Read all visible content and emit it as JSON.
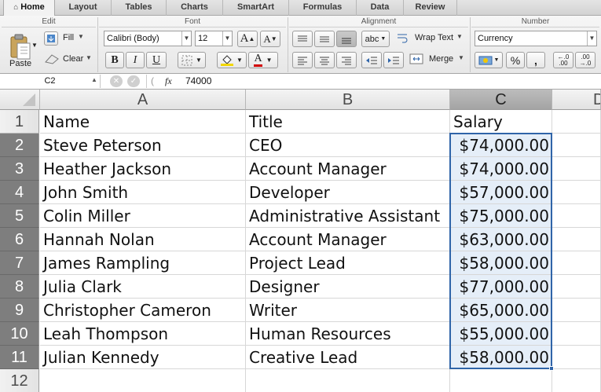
{
  "ribbon_tabs": [
    "Home",
    "Layout",
    "Tables",
    "Charts",
    "SmartArt",
    "Formulas",
    "Data",
    "Review"
  ],
  "groups": {
    "edit": "Edit",
    "font": "Font",
    "alignment": "Alignment",
    "number": "Number"
  },
  "edit": {
    "paste": "Paste",
    "fill": "Fill",
    "clear": "Clear"
  },
  "font": {
    "name": "Calibri (Body)",
    "size": "12",
    "grow": "A",
    "shrink": "A",
    "bold": "B",
    "italic": "I",
    "underline": "U",
    "font_color": "A"
  },
  "alignment": {
    "wrap_text": "Wrap Text",
    "merge": "Merge",
    "orientation": "abc"
  },
  "number": {
    "format": "Currency",
    "percent": "%",
    "comma": ",",
    "inc_decimal": ".0\n.00",
    "dec_decimal": ".00\n.0"
  },
  "formula_bar": {
    "name_box": "C2",
    "fx": "fx",
    "value": "74000"
  },
  "columns": [
    "A",
    "B",
    "C"
  ],
  "next_column_partial": "D",
  "rows": [
    {
      "n": "1",
      "a": "Name",
      "b": "Title",
      "c": "Salary"
    },
    {
      "n": "2",
      "a": "Steve Peterson",
      "b": "CEO",
      "c": "$74,000.00"
    },
    {
      "n": "3",
      "a": "Heather Jackson",
      "b": "Account Manager",
      "c": "$74,000.00"
    },
    {
      "n": "4",
      "a": "John Smith",
      "b": "Developer",
      "c": "$57,000.00"
    },
    {
      "n": "5",
      "a": "Colin Miller",
      "b": "Administrative Assistant",
      "c": "$75,000.00"
    },
    {
      "n": "6",
      "a": "Hannah Nolan",
      "b": "Account Manager",
      "c": "$63,000.00"
    },
    {
      "n": "7",
      "a": "James Rampling",
      "b": "Project Lead",
      "c": "$58,000.00"
    },
    {
      "n": "8",
      "a": "Julia Clark",
      "b": "Designer",
      "c": "$77,000.00"
    },
    {
      "n": "9",
      "a": "Christopher Cameron",
      "b": "Writer",
      "c": "$65,000.00"
    },
    {
      "n": "10",
      "a": "Leah Thompson",
      "b": "Human Resources",
      "c": "$55,000.00"
    },
    {
      "n": "11",
      "a": "Julian Kennedy",
      "b": "Creative Lead",
      "c": "$58,000.00"
    },
    {
      "n": "12",
      "a": "",
      "b": "",
      "c": ""
    }
  ],
  "selection": {
    "first_row": 2,
    "last_row": 11,
    "column": "C"
  }
}
